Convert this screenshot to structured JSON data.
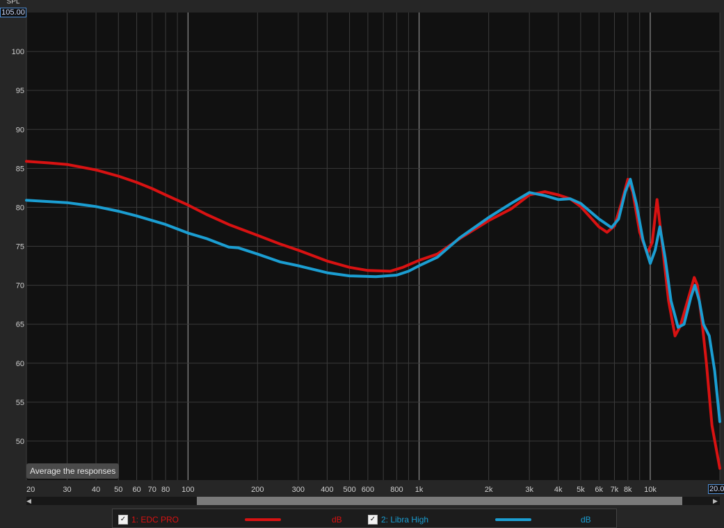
{
  "chart_data": {
    "type": "line",
    "ylabel": "SPL",
    "x_scale": "log",
    "xlim": [
      20,
      20000
    ],
    "ylim": [
      45,
      105
    ],
    "yticks": [
      50,
      55,
      60,
      65,
      70,
      75,
      80,
      85,
      90,
      95,
      100
    ],
    "xticks": [
      {
        "v": 20,
        "label": "20"
      },
      {
        "v": 30,
        "label": "30"
      },
      {
        "v": 40,
        "label": "40"
      },
      {
        "v": 50,
        "label": "50"
      },
      {
        "v": 60,
        "label": "60"
      },
      {
        "v": 70,
        "label": "70"
      },
      {
        "v": 80,
        "label": "80"
      },
      {
        "v": 100,
        "label": "100"
      },
      {
        "v": 200,
        "label": "200"
      },
      {
        "v": 300,
        "label": "300"
      },
      {
        "v": 400,
        "label": "400"
      },
      {
        "v": 500,
        "label": "500"
      },
      {
        "v": 600,
        "label": "600"
      },
      {
        "v": 800,
        "label": "800"
      },
      {
        "v": 1000,
        "label": "1k"
      },
      {
        "v": 2000,
        "label": "2k"
      },
      {
        "v": 3000,
        "label": "3k"
      },
      {
        "v": 4000,
        "label": "4k"
      },
      {
        "v": 5000,
        "label": "5k"
      },
      {
        "v": 6000,
        "label": "6k"
      },
      {
        "v": 7000,
        "label": "7k"
      },
      {
        "v": 8000,
        "label": "8k"
      },
      {
        "v": 10000,
        "label": "10k"
      }
    ],
    "series": [
      {
        "name": "1: EDC PRO",
        "unit": "dB",
        "color": "#d81212",
        "points": [
          [
            20,
            85.9
          ],
          [
            25,
            85.7
          ],
          [
            30,
            85.5
          ],
          [
            40,
            84.8
          ],
          [
            50,
            84.0
          ],
          [
            60,
            83.2
          ],
          [
            70,
            82.4
          ],
          [
            80,
            81.6
          ],
          [
            100,
            80.3
          ],
          [
            120,
            79.1
          ],
          [
            150,
            77.8
          ],
          [
            200,
            76.4
          ],
          [
            250,
            75.3
          ],
          [
            300,
            74.5
          ],
          [
            400,
            73.1
          ],
          [
            500,
            72.3
          ],
          [
            600,
            71.9
          ],
          [
            750,
            71.8
          ],
          [
            850,
            72.3
          ],
          [
            1000,
            73.2
          ],
          [
            1200,
            74.0
          ],
          [
            1500,
            76.0
          ],
          [
            2000,
            78.3
          ],
          [
            2500,
            79.8
          ],
          [
            3000,
            81.6
          ],
          [
            3500,
            82.0
          ],
          [
            4000,
            81.6
          ],
          [
            4500,
            81.1
          ],
          [
            5000,
            80.1
          ],
          [
            6000,
            77.5
          ],
          [
            6500,
            76.8
          ],
          [
            7000,
            77.6
          ],
          [
            7500,
            80.5
          ],
          [
            8000,
            83.6
          ],
          [
            8400,
            82.0
          ],
          [
            9000,
            76.8
          ],
          [
            9700,
            74.1
          ],
          [
            10200,
            75.5
          ],
          [
            10700,
            81.0
          ],
          [
            11200,
            76.0
          ],
          [
            12000,
            68.0
          ],
          [
            12800,
            63.5
          ],
          [
            13500,
            64.8
          ],
          [
            15000,
            69.5
          ],
          [
            15500,
            71.0
          ],
          [
            16000,
            70.0
          ],
          [
            16800,
            65.0
          ],
          [
            17500,
            60.0
          ],
          [
            18500,
            52.0
          ],
          [
            20000,
            46.5
          ]
        ]
      },
      {
        "name": "2: Libra High",
        "unit": "dB",
        "color": "#1b9ed2",
        "points": [
          [
            20,
            80.9
          ],
          [
            30,
            80.6
          ],
          [
            40,
            80.1
          ],
          [
            50,
            79.5
          ],
          [
            60,
            78.9
          ],
          [
            80,
            77.8
          ],
          [
            100,
            76.7
          ],
          [
            120,
            76.0
          ],
          [
            150,
            74.9
          ],
          [
            165,
            74.8
          ],
          [
            200,
            74.0
          ],
          [
            250,
            73.0
          ],
          [
            300,
            72.5
          ],
          [
            400,
            71.6
          ],
          [
            500,
            71.2
          ],
          [
            650,
            71.1
          ],
          [
            800,
            71.3
          ],
          [
            900,
            71.8
          ],
          [
            1000,
            72.5
          ],
          [
            1200,
            73.6
          ],
          [
            1500,
            76.1
          ],
          [
            2000,
            78.7
          ],
          [
            2500,
            80.5
          ],
          [
            3000,
            81.9
          ],
          [
            3500,
            81.5
          ],
          [
            4000,
            81.0
          ],
          [
            4500,
            81.1
          ],
          [
            5000,
            80.5
          ],
          [
            6000,
            78.5
          ],
          [
            6800,
            77.4
          ],
          [
            7300,
            78.5
          ],
          [
            7800,
            82.0
          ],
          [
            8200,
            83.6
          ],
          [
            8700,
            80.5
          ],
          [
            9300,
            75.8
          ],
          [
            10000,
            72.8
          ],
          [
            10500,
            74.5
          ],
          [
            11000,
            77.5
          ],
          [
            11600,
            73.5
          ],
          [
            12300,
            68.0
          ],
          [
            13200,
            64.6
          ],
          [
            14000,
            65.0
          ],
          [
            15000,
            68.5
          ],
          [
            15600,
            70.0
          ],
          [
            16300,
            68.0
          ],
          [
            17000,
            65.0
          ],
          [
            18000,
            63.5
          ],
          [
            19000,
            59.0
          ],
          [
            20000,
            52.5
          ]
        ]
      }
    ]
  },
  "ui": {
    "ylabel_tag": "SPL",
    "ymax_box": "105.00",
    "xmax_box": "20.0",
    "avg_button": "Average the responses",
    "legend": [
      {
        "check": "✓",
        "name": "1: EDC PRO",
        "unit": "dB",
        "color": "#d81212"
      },
      {
        "check": "✓",
        "name": "2: Libra High",
        "unit": "dB",
        "color": "#1b9ed2"
      }
    ],
    "scroll_left_icon": "◀",
    "scroll_right_icon": "▶"
  }
}
